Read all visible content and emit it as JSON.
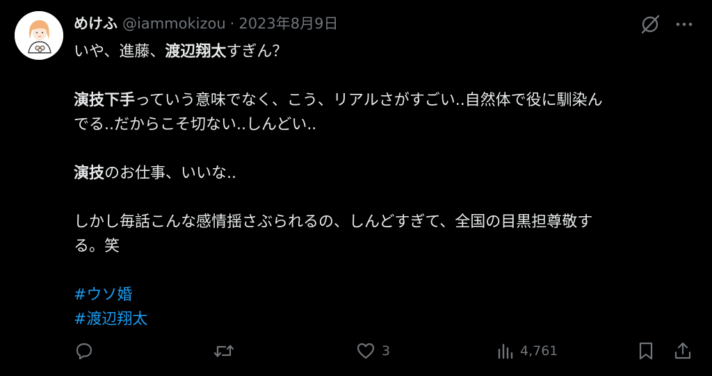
{
  "header": {
    "display_name": "めけふ",
    "handle": "@iammokizou",
    "separator": "·",
    "date": "2023年8月9日"
  },
  "body": {
    "line1_pre": "いや、進藤、",
    "line1_bold": "渡辺翔太",
    "line1_post": "すぎん？",
    "para2_bold": "演技下手",
    "para2_rest_a": "っていう意味でなく、こう、リアルさがすごい..自然体で役に馴染ん",
    "para2_rest_b": "でる..だからこそ切ない..しんどい..",
    "para3_bold": "演技",
    "para3_rest": "のお仕事、いいな..",
    "para4_a": "しかし毎話こんな感情揺さぶられるの、しんどすぎて、全国の目黒担尊敬す",
    "para4_b": "る。笑",
    "hashtags": [
      "#ウソ婚",
      "#渡辺翔太"
    ]
  },
  "actions": {
    "reply_count": "",
    "retweet_count": "",
    "like_count": "3",
    "views_count": "4,761"
  },
  "icons": {
    "avatar": "illustrated-woman-avatar",
    "grok": "grok-slash-circle-icon",
    "more": "more-dots-icon",
    "reply": "reply-icon",
    "retweet": "retweet-icon",
    "like": "heart-icon",
    "views": "views-bar-icon",
    "bookmark": "bookmark-icon",
    "share": "share-icon"
  },
  "colors": {
    "background": "#000000",
    "text": "#e7e9ea",
    "secondary": "#71767b",
    "link": "#1d9bf0"
  }
}
